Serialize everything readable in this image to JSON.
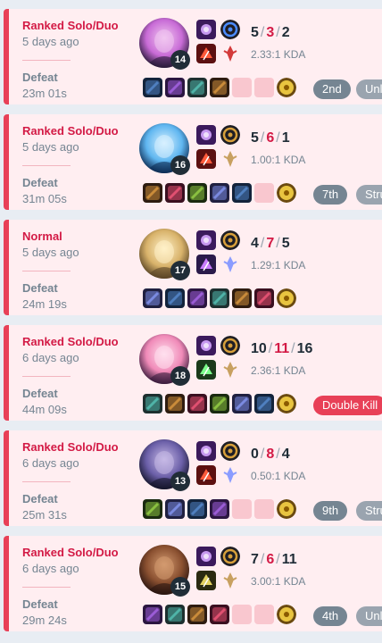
{
  "colors": {
    "loss_border": "#e84057",
    "loss_bg": "#ffeef1",
    "accent_red": "#d31a45",
    "muted": "#758592"
  },
  "matches": [
    {
      "queue": "Ranked Solo/Duo",
      "ago": "5 days ago",
      "result": "Defeat",
      "duration": "23m 01s",
      "champion_icon": "champion-portrait-pink",
      "level": "14",
      "kills": "5",
      "deaths": "3",
      "assists": "2",
      "kda": "2.33:1 KDA",
      "spells": [
        "flash-icon",
        "ignite-icon"
      ],
      "runes": [
        "electrocute-icon",
        "domination-rune-icon"
      ],
      "items": [
        "item-1",
        "item-2",
        "item-3",
        "item-4",
        "empty",
        "empty",
        "ward"
      ],
      "badges": [
        {
          "text": "2nd",
          "kind": "place"
        },
        {
          "text": "Unlucky",
          "kind": "tag"
        }
      ]
    },
    {
      "queue": "Ranked Solo/Duo",
      "ago": "5 days ago",
      "result": "Defeat",
      "duration": "31m 05s",
      "champion_icon": "champion-portrait-ice",
      "level": "16",
      "kills": "5",
      "deaths": "6",
      "assists": "1",
      "kda": "1.00:1 KDA",
      "spells": [
        "flash-icon",
        "ignite-icon"
      ],
      "runes": [
        "conqueror-icon",
        "precision-rune-icon"
      ],
      "items": [
        "item-1",
        "item-2",
        "item-3",
        "item-4",
        "item-5",
        "empty",
        "ward"
      ],
      "badges": [
        {
          "text": "7th",
          "kind": "place"
        },
        {
          "text": "Struggle",
          "kind": "tag"
        }
      ]
    },
    {
      "queue": "Normal",
      "ago": "5 days ago",
      "result": "Defeat",
      "duration": "24m 19s",
      "champion_icon": "champion-portrait-gold",
      "level": "17",
      "kills": "4",
      "deaths": "7",
      "assists": "5",
      "kda": "1.29:1 KDA",
      "spells": [
        "flash-icon",
        "teleport-icon"
      ],
      "runes": [
        "fleet-icon",
        "sorcery-rune-icon"
      ],
      "items": [
        "item-1",
        "item-2",
        "item-3",
        "item-4",
        "item-5",
        "item-6",
        "ward"
      ],
      "badges": []
    },
    {
      "queue": "Ranked Solo/Duo",
      "ago": "6 days ago",
      "result": "Defeat",
      "duration": "44m 09s",
      "champion_icon": "champion-portrait-pinkhair",
      "level": "18",
      "kills": "10",
      "deaths": "11",
      "assists": "16",
      "kda": "2.36:1 KDA",
      "spells": [
        "flash-icon",
        "heal-icon"
      ],
      "runes": [
        "conqueror-icon",
        "precision-rune-icon"
      ],
      "items": [
        "item-1",
        "item-2",
        "item-3",
        "item-4",
        "item-5",
        "item-6",
        "ward"
      ],
      "badges": [
        {
          "text": "Double Kill",
          "kind": "red"
        }
      ]
    },
    {
      "queue": "Ranked Solo/Duo",
      "ago": "6 days ago",
      "result": "Defeat",
      "duration": "25m 31s",
      "champion_icon": "champion-portrait-dark",
      "level": "13",
      "kills": "0",
      "deaths": "8",
      "assists": "4",
      "kda": "0.50:1 KDA",
      "spells": [
        "flash-icon",
        "ignite-icon"
      ],
      "runes": [
        "fleet-icon",
        "sorcery-rune-icon"
      ],
      "items": [
        "item-1",
        "item-2",
        "item-3",
        "item-4",
        "empty",
        "empty",
        "ward"
      ],
      "badges": [
        {
          "text": "9th",
          "kind": "place"
        },
        {
          "text": "Struggle",
          "kind": "tag"
        }
      ]
    },
    {
      "queue": "Ranked Solo/Duo",
      "ago": "6 days ago",
      "result": "Defeat",
      "duration": "29m 24s",
      "champion_icon": "champion-portrait-brown",
      "level": "15",
      "kills": "7",
      "deaths": "6",
      "assists": "11",
      "kda": "3.00:1 KDA",
      "spells": [
        "flash-icon",
        "exhaust-icon"
      ],
      "runes": [
        "conqueror-icon",
        "precision-rune-icon"
      ],
      "items": [
        "item-1",
        "item-2",
        "item-3",
        "item-4",
        "empty",
        "empty",
        "ward"
      ],
      "badges": [
        {
          "text": "4th",
          "kind": "place"
        },
        {
          "text": "Unlucky",
          "kind": "tag"
        }
      ]
    }
  ]
}
